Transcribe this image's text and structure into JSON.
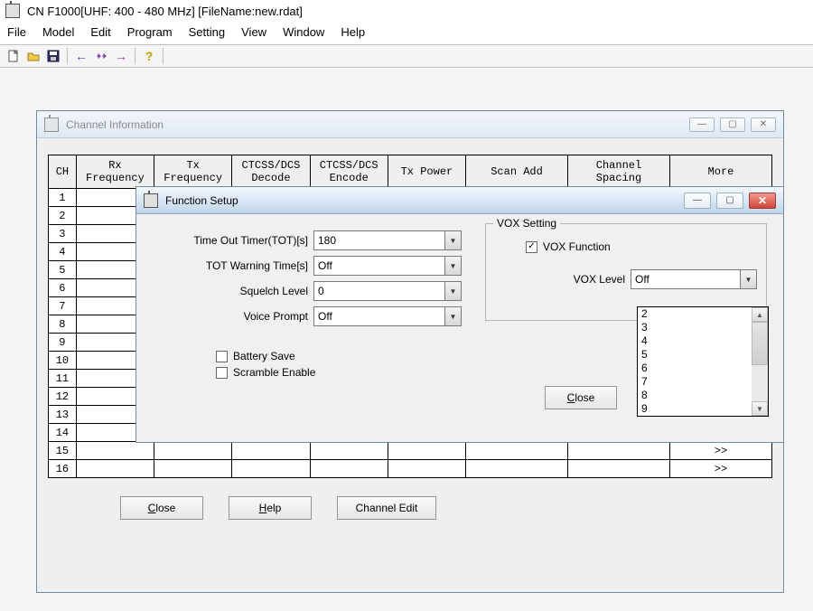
{
  "app": {
    "title": "CN F1000[UHF: 400 - 480 MHz] [FileName:new.rdat]"
  },
  "menu": {
    "items": [
      "File",
      "Model",
      "Edit",
      "Program",
      "Setting",
      "View",
      "Window",
      "Help"
    ]
  },
  "channel_win": {
    "title": "Channel Information",
    "headers": {
      "ch": "CH",
      "rx": "Rx\nFrequency",
      "tx": "Tx\nFrequency",
      "dec": "CTCSS/DCS\nDecode",
      "enc": "CTCSS/DCS\nEncode",
      "pw": "Tx Power",
      "scan": "Scan Add",
      "sp": "Channel\nSpacing",
      "more": "More"
    },
    "rows": 16,
    "more_glyph": ">>",
    "buttons": {
      "close": "Close",
      "help": "Help",
      "chedit": "Channel Edit"
    }
  },
  "func_win": {
    "title": "Function Setup",
    "tot": {
      "label": "Time Out Timer(TOT)[s]",
      "value": "180"
    },
    "tot_warn": {
      "label": "TOT Warning Time[s]",
      "value": "Off"
    },
    "squelch": {
      "label": "Squelch Level",
      "value": "0"
    },
    "voice": {
      "label": "Voice Prompt",
      "value": "Off"
    },
    "battery_save": {
      "label": "Battery Save",
      "checked": false
    },
    "scramble": {
      "label": "Scramble Enable",
      "checked": false
    },
    "vox": {
      "legend": "VOX Setting",
      "func_label": "VOX Function",
      "func_checked": true,
      "level_label": "VOX Level",
      "level_value": "Off",
      "options": [
        "2",
        "3",
        "4",
        "5",
        "6",
        "7",
        "8",
        "9"
      ]
    },
    "close_btn": "Close"
  }
}
